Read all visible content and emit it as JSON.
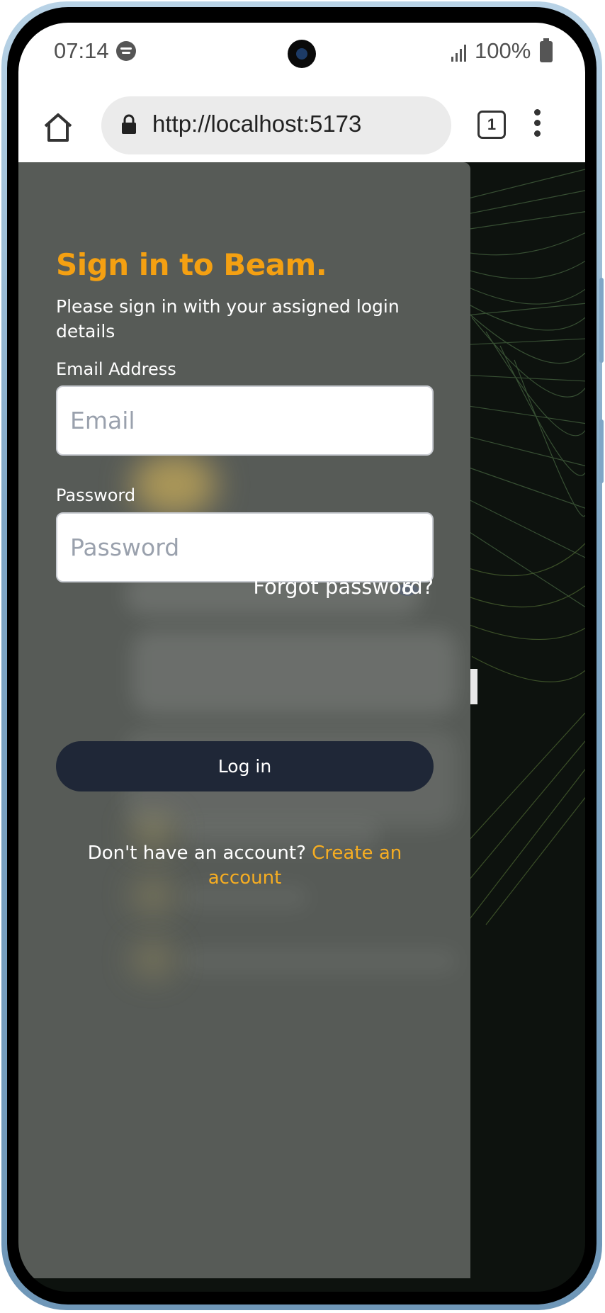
{
  "status_bar": {
    "time": "07:14",
    "battery": "100%",
    "icons": [
      "spotify-icon",
      "signal-icon",
      "battery-icon"
    ]
  },
  "browser": {
    "url": "http://localhost:5173",
    "tab_count": "1",
    "icons": [
      "home-icon",
      "lock-icon",
      "tabs-icon",
      "more-menu-icon"
    ]
  },
  "login": {
    "title": "Sign in to Beam.",
    "subtitle": "Please sign in with your assigned login details",
    "email_label": "Email Address",
    "email_placeholder": "Email",
    "password_label": "Password",
    "password_placeholder": "Password",
    "forgot_password": "Forgot password?",
    "login_button": "Log in",
    "no_account_text": "Don't have an account?",
    "create_account_link": "Create an account"
  },
  "colors": {
    "title_accent": "#f4a012",
    "link_accent": "#f6ad22",
    "button_bg": "#1f2737",
    "panel_bg": "#575b57"
  }
}
